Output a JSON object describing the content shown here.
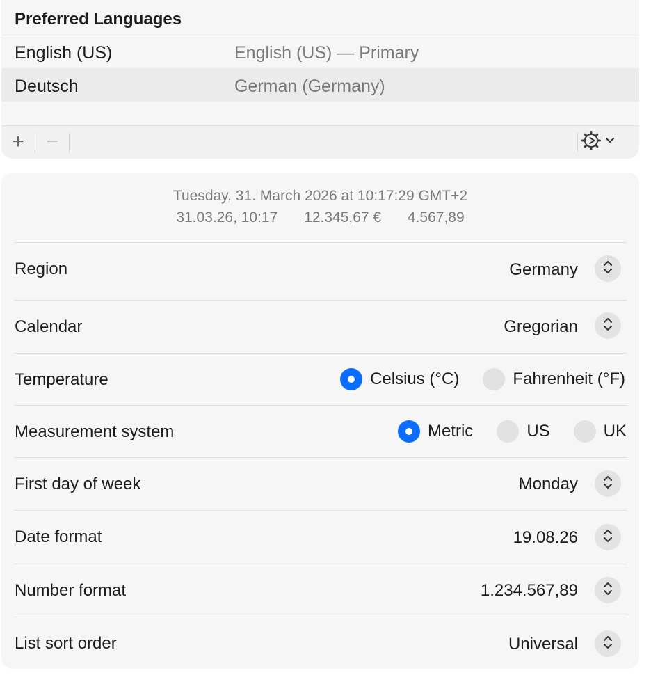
{
  "languages": {
    "title": "Preferred Languages",
    "items": [
      {
        "name": "English (US)",
        "description": "English (US) — Primary"
      },
      {
        "name": "Deutsch",
        "description": "German (Germany)"
      }
    ],
    "add_label": "+",
    "remove_label": "−"
  },
  "preview": {
    "full_date": "Tuesday, 31. March 2026 at 10:17:29 GMT+2",
    "short_date": "31.03.26, 10:17",
    "currency": "12.345,67 €",
    "number": "4.567,89"
  },
  "settings": {
    "region": {
      "label": "Region",
      "value": "Germany"
    },
    "calendar": {
      "label": "Calendar",
      "value": "Gregorian"
    },
    "temperature": {
      "label": "Temperature",
      "options": [
        "Celsius (°C)",
        "Fahrenheit (°F)"
      ],
      "selected": "Celsius (°C)"
    },
    "measurement": {
      "label": "Measurement system",
      "options": [
        "Metric",
        "US",
        "UK"
      ],
      "selected": "Metric"
    },
    "first_day": {
      "label": "First day of week",
      "value": "Monday"
    },
    "date_format": {
      "label": "Date format",
      "value": "19.08.26"
    },
    "number_format": {
      "label": "Number format",
      "value": "1.234.567,89"
    },
    "sort_order": {
      "label": "List sort order",
      "value": "Universal"
    }
  },
  "colors": {
    "accent": "#0a6dff",
    "panel": "#f6f6f6",
    "secondary_text": "#7a7a7a"
  },
  "icons": {
    "action_menu": "gear-icon",
    "chevron": "chevron-down-icon",
    "stepper": "up-down-chevron-icon"
  }
}
